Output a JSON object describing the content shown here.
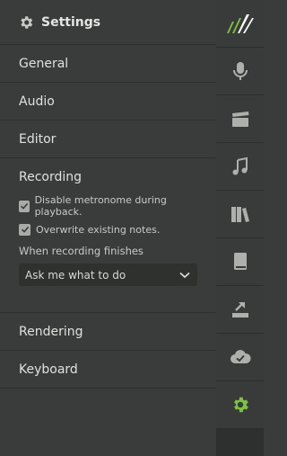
{
  "header": {
    "title": "Settings",
    "icon": "gear-icon"
  },
  "nav": {
    "general": "General",
    "audio": "Audio",
    "editor": "Editor",
    "recording": "Recording",
    "rendering": "Rendering",
    "keyboard": "Keyboard"
  },
  "recording": {
    "options": [
      {
        "label": "Disable metronome during playback.",
        "checked": true
      },
      {
        "label": "Overwrite existing notes.",
        "checked": true
      }
    ],
    "finish_label": "When recording finishes",
    "finish_value": "Ask me what to do"
  },
  "rail": {
    "items": [
      {
        "icon": "app-logo-icon"
      },
      {
        "icon": "microphone-icon"
      },
      {
        "icon": "clapperboard-icon"
      },
      {
        "icon": "music-note-icon"
      },
      {
        "icon": "library-icon"
      },
      {
        "icon": "book-icon"
      },
      {
        "icon": "export-icon"
      },
      {
        "icon": "cloud-check-icon"
      },
      {
        "icon": "gear-icon",
        "active": true
      }
    ]
  },
  "colors": {
    "accent": "#7dc242",
    "panel_bg": "#3a3c3b",
    "rail_bg": "#393b3a",
    "rail_empty": "#2e302f"
  }
}
